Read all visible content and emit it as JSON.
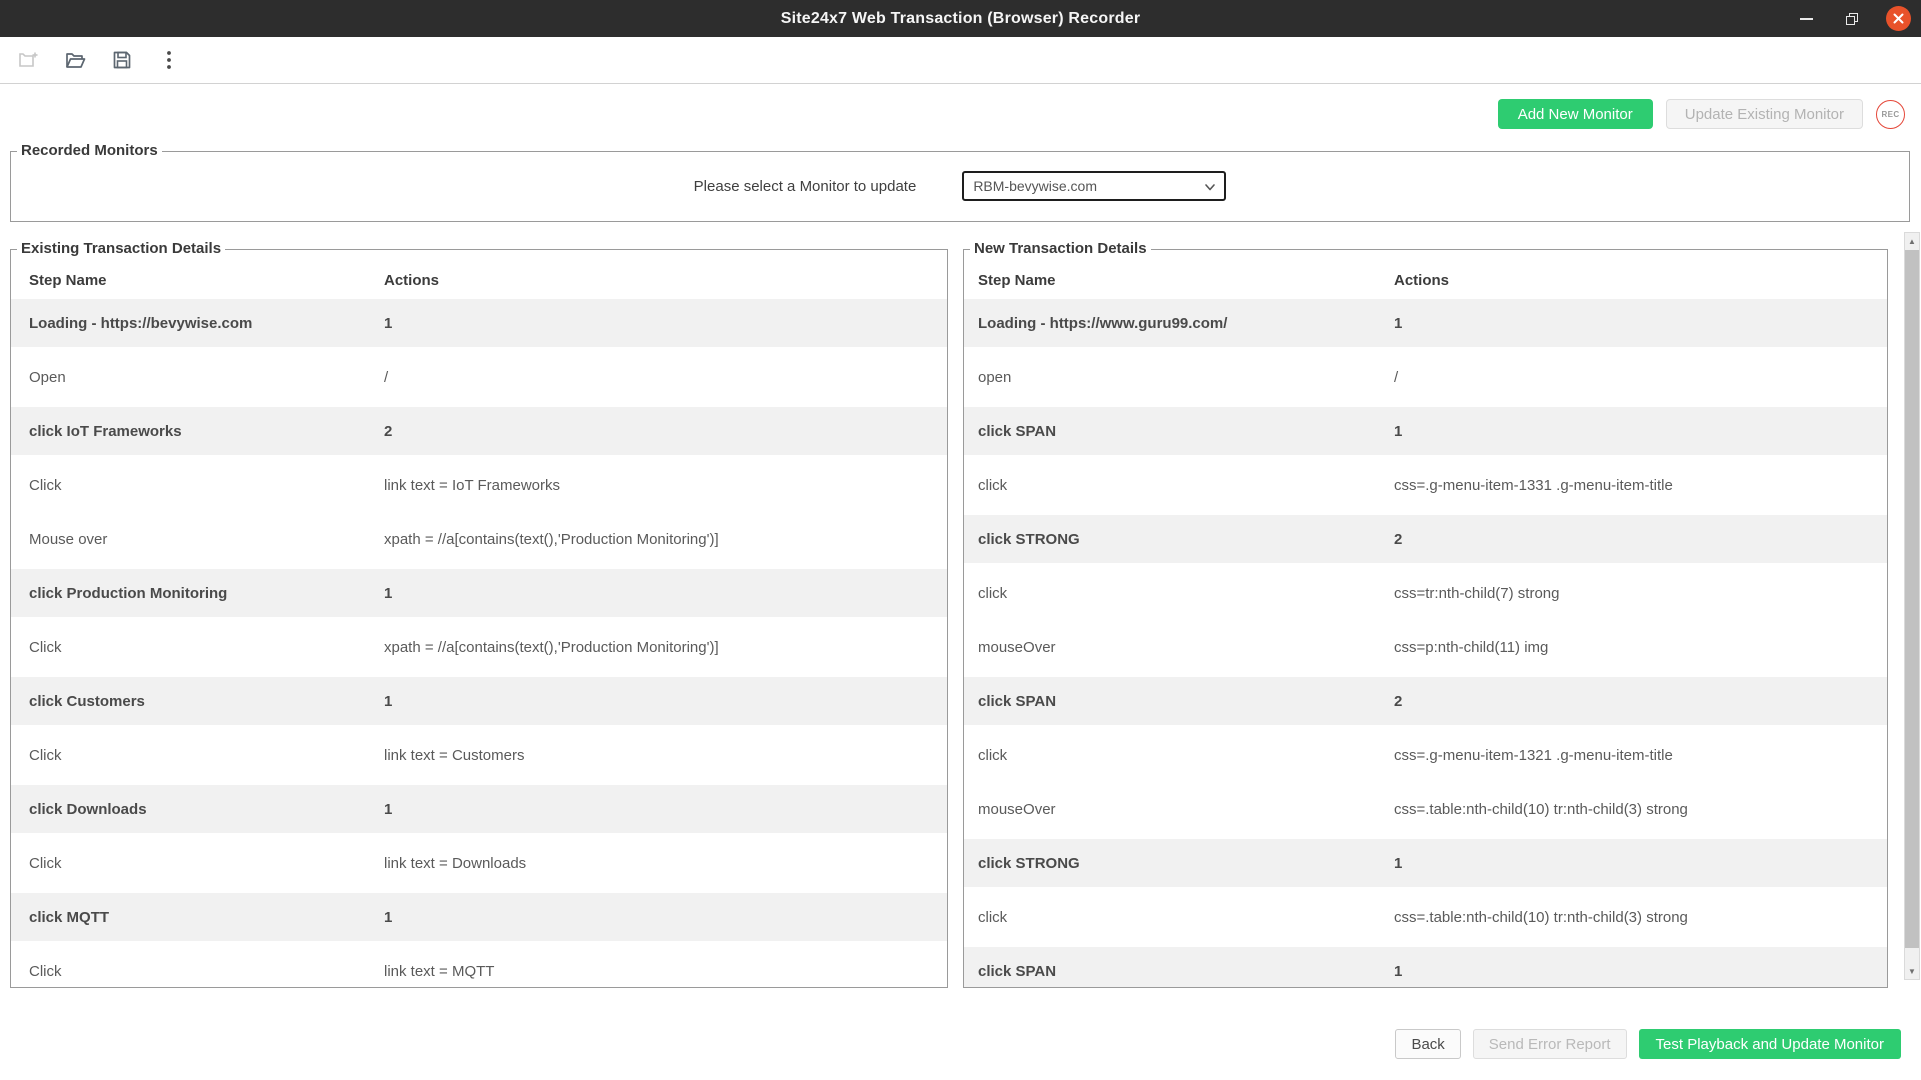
{
  "window": {
    "title": "Site24x7 Web Transaction (Browser) Recorder"
  },
  "toolbar": {
    "icons": [
      "new-monitor-icon",
      "open-folder-icon",
      "save-icon",
      "more-options-icon"
    ]
  },
  "header_actions": {
    "add_new": "Add New Monitor",
    "update_existing": "Update Existing Monitor",
    "rec": "REC"
  },
  "recorded_monitors": {
    "legend": "Recorded Monitors",
    "label": "Please select a Monitor to update",
    "selected_monitor": "RBM-bevywise.com"
  },
  "existing_panel": {
    "legend": "Existing Transaction Details",
    "headers": {
      "step": "Step Name",
      "actions": "Actions"
    },
    "rows": [
      {
        "name": "Loading - https://bevywise.com",
        "action": "1",
        "step": true
      },
      {
        "name": "Open",
        "action": "/",
        "step": false
      },
      {
        "name": "click IoT Frameworks",
        "action": "2",
        "step": true
      },
      {
        "name": "Click",
        "action": "link text = IoT Frameworks",
        "step": false
      },
      {
        "name": "Mouse over",
        "action": "xpath = //a[contains(text(),'Production Monitoring')]",
        "step": false
      },
      {
        "name": "click Production Monitoring",
        "action": "1",
        "step": true
      },
      {
        "name": "Click",
        "action": "xpath = //a[contains(text(),'Production Monitoring')]",
        "step": false
      },
      {
        "name": "click Customers",
        "action": "1",
        "step": true
      },
      {
        "name": "Click",
        "action": "link text = Customers",
        "step": false
      },
      {
        "name": "click Downloads",
        "action": "1",
        "step": true
      },
      {
        "name": "Click",
        "action": "link text = Downloads",
        "step": false
      },
      {
        "name": "click MQTT",
        "action": "1",
        "step": true
      },
      {
        "name": "Click",
        "action": "link text = MQTT",
        "step": false
      }
    ]
  },
  "new_panel": {
    "legend": "New Transaction Details",
    "headers": {
      "step": "Step Name",
      "actions": "Actions"
    },
    "rows": [
      {
        "name": "Loading - https://www.guru99.com/",
        "action": "1",
        "step": true
      },
      {
        "name": "open",
        "action": "/",
        "step": false
      },
      {
        "name": "click SPAN",
        "action": "1",
        "step": true
      },
      {
        "name": "click",
        "action": "css=.g-menu-item-1331 .g-menu-item-title",
        "step": false
      },
      {
        "name": "click STRONG",
        "action": "2",
        "step": true
      },
      {
        "name": "click",
        "action": "css=tr:nth-child(7) strong",
        "step": false
      },
      {
        "name": "mouseOver",
        "action": "css=p:nth-child(11) img",
        "step": false
      },
      {
        "name": "click SPAN",
        "action": "2",
        "step": true
      },
      {
        "name": "click",
        "action": "css=.g-menu-item-1321 .g-menu-item-title",
        "step": false
      },
      {
        "name": "mouseOver",
        "action": "css=.table:nth-child(10) tr:nth-child(3) strong",
        "step": false
      },
      {
        "name": "click STRONG",
        "action": "1",
        "step": true
      },
      {
        "name": "click",
        "action": "css=.table:nth-child(10) tr:nth-child(3) strong",
        "step": false
      },
      {
        "name": "click SPAN",
        "action": "1",
        "step": true
      }
    ]
  },
  "footer": {
    "back": "Back",
    "send_error_report": "Send Error Report",
    "test_playback": "Test Playback and Update Monitor"
  },
  "colors": {
    "titlebar": "#2d2d2d",
    "accent_green": "#2ecc71",
    "close_button": "#e8522a",
    "rec_ring_red": "#e5483a",
    "row_highlight": "#f1f1f1"
  }
}
